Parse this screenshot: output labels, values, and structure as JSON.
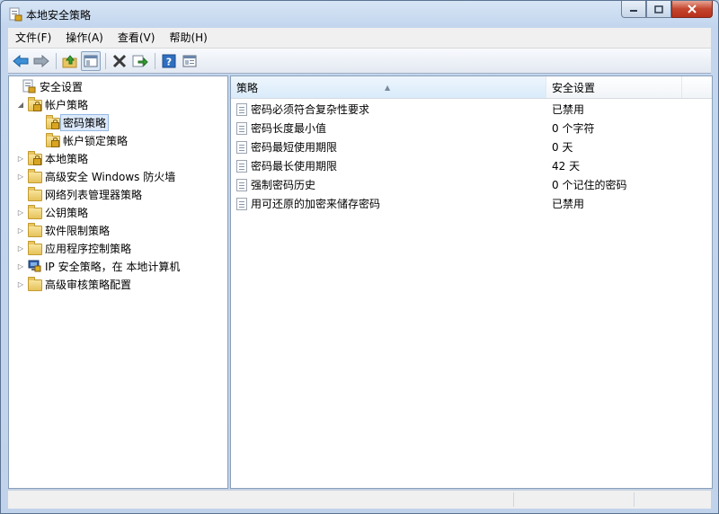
{
  "window": {
    "title": "本地安全策略"
  },
  "menu": [
    {
      "label": "文件(F)"
    },
    {
      "label": "操作(A)"
    },
    {
      "label": "查看(V)"
    },
    {
      "label": "帮助(H)"
    }
  ],
  "toolbar": {
    "icons": [
      "back-icon",
      "forward-icon",
      "up-folder-icon",
      "show-hide-tree-icon",
      "delete-icon",
      "export-list-icon",
      "help-icon",
      "properties-icon"
    ]
  },
  "tree": {
    "root": "安全设置",
    "items": [
      {
        "label": "帐户策略"
      },
      {
        "label": "密码策略"
      },
      {
        "label": "帐户锁定策略"
      },
      {
        "label": "本地策略"
      },
      {
        "label": "高级安全 Windows 防火墙"
      },
      {
        "label": "网络列表管理器策略"
      },
      {
        "label": "公钥策略"
      },
      {
        "label": "软件限制策略"
      },
      {
        "label": "应用程序控制策略"
      },
      {
        "label": "IP 安全策略，在 本地计算机"
      },
      {
        "label": "高级审核策略配置"
      }
    ]
  },
  "list": {
    "columns": [
      "策略",
      "安全设置"
    ],
    "rows": [
      {
        "policy": "密码必须符合复杂性要求",
        "setting": "已禁用"
      },
      {
        "policy": "密码长度最小值",
        "setting": "0 个字符"
      },
      {
        "policy": "密码最短使用期限",
        "setting": "0 天"
      },
      {
        "policy": "密码最长使用期限",
        "setting": "42 天"
      },
      {
        "policy": "强制密码历史",
        "setting": "0 个记住的密码"
      },
      {
        "policy": "用可还原的加密来储存密码",
        "setting": "已禁用"
      }
    ]
  }
}
